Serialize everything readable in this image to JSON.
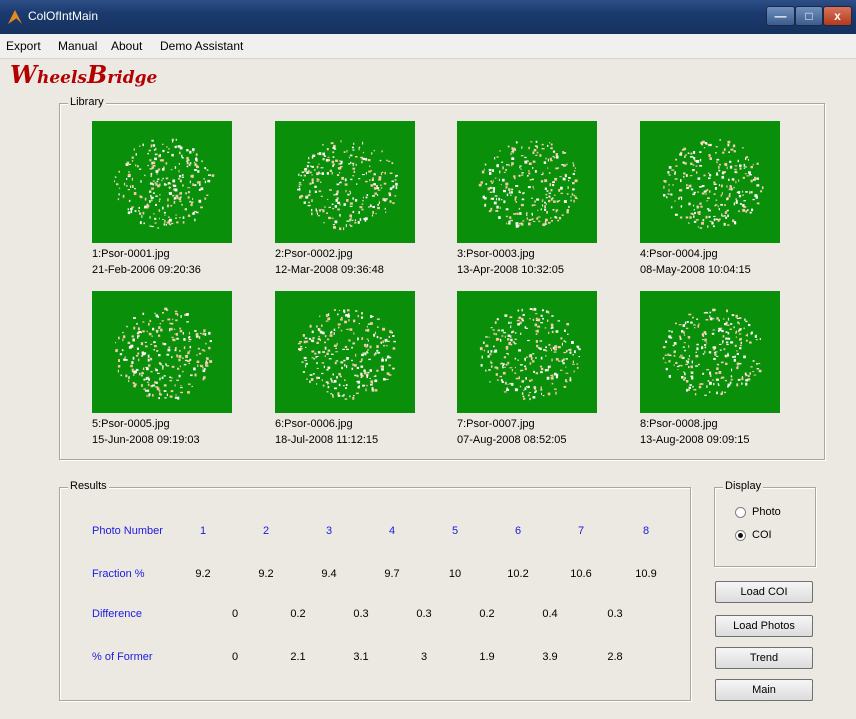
{
  "window": {
    "title": "ColOfIntMain",
    "minimize": "—",
    "maximize": "□",
    "close": "x"
  },
  "menu": [
    "Export",
    "Manual",
    "About",
    "Demo Assistant"
  ],
  "logo": {
    "w": "W",
    "heels": "heels",
    "b": "B",
    "ridge": "ridge"
  },
  "library": {
    "label": "Library",
    "photos": [
      {
        "name": "1:Psor-0001.jpg",
        "date": "21-Feb-2006 09:20:36"
      },
      {
        "name": "2:Psor-0002.jpg",
        "date": "12-Mar-2008 09:36:48"
      },
      {
        "name": "3:Psor-0003.jpg",
        "date": "13-Apr-2008 10:32:05"
      },
      {
        "name": "4:Psor-0004.jpg",
        "date": "08-May-2008 10:04:15"
      },
      {
        "name": "5:Psor-0005.jpg",
        "date": "15-Jun-2008 09:19:03"
      },
      {
        "name": "6:Psor-0006.jpg",
        "date": "18-Jul-2008 11:12:15"
      },
      {
        "name": "7:Psor-0007.jpg",
        "date": "07-Aug-2008 08:52:05"
      },
      {
        "name": "8:Psor-0008.jpg",
        "date": "13-Aug-2008 09:09:15"
      }
    ]
  },
  "results": {
    "label": "Results",
    "rows": {
      "photo_number": {
        "label": "Photo Number",
        "values": [
          "1",
          "2",
          "3",
          "4",
          "5",
          "6",
          "7",
          "8"
        ]
      },
      "fraction": {
        "label": "Fraction %",
        "values": [
          "9.2",
          "9.2",
          "9.4",
          "9.7",
          "10",
          "10.2",
          "10.6",
          "10.9"
        ]
      },
      "difference": {
        "label": "Difference",
        "values": [
          "0",
          "0.2",
          "0.3",
          "0.3",
          "0.2",
          "0.4",
          "0.3"
        ]
      },
      "pct_former": {
        "label": "% of Former",
        "values": [
          "0",
          "2.1",
          "3.1",
          "3",
          "1.9",
          "3.9",
          "2.8"
        ]
      }
    }
  },
  "display": {
    "label": "Display",
    "photo": "Photo",
    "coi": "COI",
    "selected": "COI"
  },
  "buttons": {
    "load_coi": "Load COI",
    "load_photos": "Load Photos",
    "trend": "Trend",
    "main": "Main"
  },
  "colors": {
    "thumb_green": "#0a8f0a",
    "accent_blue": "#1b1be0",
    "logo_red": "#b30000"
  }
}
